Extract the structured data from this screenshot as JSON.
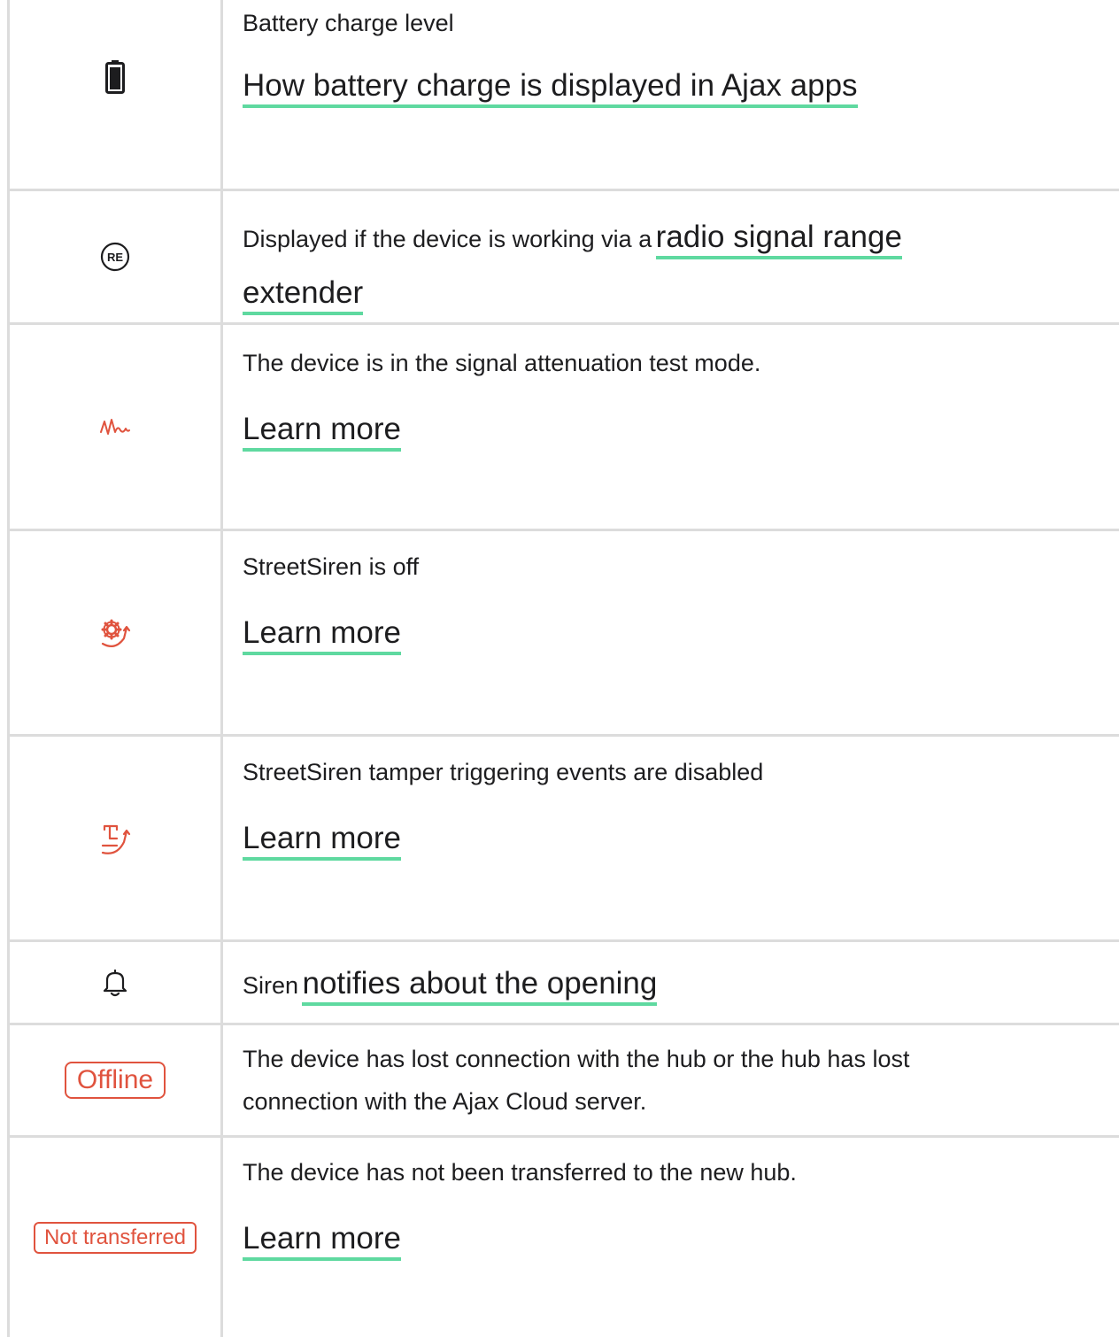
{
  "rows": [
    {
      "icon": "battery-icon",
      "text": "Battery charge level",
      "link": "How battery charge is displayed in Ajax apps"
    },
    {
      "icon": "range-extender-re-icon",
      "icon_text": "RE",
      "text": "Displayed if the device is working via a",
      "link_part1": "radio signal range",
      "link_part2": "extender"
    },
    {
      "icon": "signal-attenuation-icon",
      "text": "The device is in the signal attenuation test mode.",
      "link": "Learn more"
    },
    {
      "icon": "street-siren-off-icon",
      "text": "StreetSiren is off",
      "link": "Learn more"
    },
    {
      "icon": "street-siren-tamper-off-icon",
      "text": "StreetSiren tamper triggering events are disabled",
      "link": "Learn more"
    },
    {
      "icon": "bell-icon",
      "text": "Siren",
      "link": "notifies about the opening"
    },
    {
      "badge": "Offline",
      "text_line1": "The device has lost connection with the hub or the hub has lost",
      "text_line2": "connection with the Ajax Cloud server."
    },
    {
      "badge": "Not transferred",
      "text": "The device has not been transferred to the new hub.",
      "link": "Learn more"
    }
  ],
  "colors": {
    "accent_red": "#e0533e",
    "link_underline": "#5fd9a0",
    "grid_line": "#dcdcdc",
    "text": "#1d1d1f"
  }
}
